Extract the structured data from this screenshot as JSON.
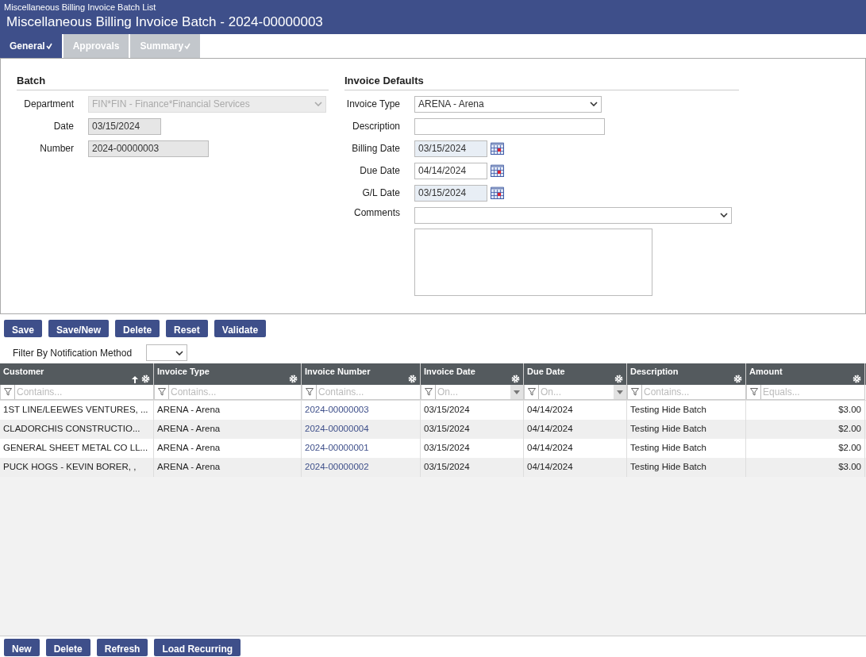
{
  "header": {
    "breadcrumb": "Miscellaneous Billing Invoice Batch List",
    "title": "Miscellaneous Billing Invoice Batch - 2024-00000003"
  },
  "tabs": [
    {
      "label": "General",
      "selected": true,
      "validated": true
    },
    {
      "label": "Approvals",
      "selected": false,
      "validated": false
    },
    {
      "label": "Summary",
      "selected": false,
      "validated": true
    }
  ],
  "batch": {
    "heading": "Batch",
    "fields": [
      {
        "label": "Department",
        "kind": "select",
        "value": "FIN*FIN - Finance*Financial Services",
        "disabled": true
      },
      {
        "label": "Date",
        "kind": "text",
        "value": "03/15/2024",
        "disabled": true
      },
      {
        "label": "Number",
        "kind": "text",
        "value": "2024-00000003",
        "disabled": true
      }
    ]
  },
  "invoice_defaults": {
    "heading": "Invoice Defaults",
    "fields": [
      {
        "label": "Invoice Type",
        "kind": "select",
        "value": "ARENA - Arena",
        "disabled": false
      },
      {
        "label": "Description",
        "kind": "text",
        "disabled": false
      },
      {
        "label": "Billing Date",
        "kind": "date",
        "value": "03/15/2024",
        "disabled": true
      },
      {
        "label": "Due Date",
        "kind": "date",
        "value": "04/14/2024",
        "disabled": false
      },
      {
        "label": "G/L Date",
        "kind": "date",
        "value": "03/15/2024",
        "disabled": true
      },
      {
        "label": "Comments",
        "kind": "memo",
        "disabled": false
      }
    ]
  },
  "form_buttons": [
    "Save",
    "Save/New",
    "Delete",
    "Reset",
    "Validate"
  ],
  "filter": {
    "label": "Filter By Notification Method"
  },
  "grid": {
    "columns": [
      {
        "title": "Customer",
        "sorted": true,
        "filter_placeholder": "Contains...",
        "filter_dropdown": false,
        "link": false,
        "align_right": false
      },
      {
        "title": "Invoice Type",
        "sorted": false,
        "filter_placeholder": "Contains...",
        "filter_dropdown": false,
        "link": false,
        "align_right": false
      },
      {
        "title": "Invoice Number",
        "sorted": false,
        "filter_placeholder": "Contains...",
        "filter_dropdown": false,
        "link": true,
        "align_right": false
      },
      {
        "title": "Invoice Date",
        "sorted": false,
        "filter_placeholder": "On...",
        "filter_dropdown": true,
        "link": false,
        "align_right": false
      },
      {
        "title": "Due Date",
        "sorted": false,
        "filter_placeholder": "On...",
        "filter_dropdown": true,
        "link": false,
        "align_right": false
      },
      {
        "title": "Description",
        "sorted": false,
        "filter_placeholder": "Contains...",
        "filter_dropdown": false,
        "link": false,
        "align_right": false
      },
      {
        "title": "Amount",
        "sorted": false,
        "filter_placeholder": "Equals...",
        "filter_dropdown": false,
        "link": false,
        "align_right": true
      }
    ],
    "rows": [
      {
        "cells": [
          "1ST LINE/LEEWES VENTURES, ...",
          "ARENA - Arena",
          "2024-00000003",
          "03/15/2024",
          "04/14/2024",
          "Testing Hide Batch",
          "$3.00"
        ]
      },
      {
        "cells": [
          "CLADORCHIS CONSTRUCTIO...",
          "ARENA - Arena",
          "2024-00000004",
          "03/15/2024",
          "04/14/2024",
          "Testing Hide Batch",
          "$2.00"
        ]
      },
      {
        "cells": [
          "GENERAL SHEET METAL CO LL...",
          "ARENA - Arena",
          "2024-00000001",
          "03/15/2024",
          "04/14/2024",
          "Testing Hide Batch",
          "$2.00"
        ]
      },
      {
        "cells": [
          "PUCK HOGS - KEVIN BORER, ,",
          "ARENA - Arena",
          "2024-00000002",
          "03/15/2024",
          "04/14/2024",
          "Testing Hide Batch",
          "$3.00"
        ]
      }
    ]
  },
  "grid_buttons": [
    "New",
    "Delete",
    "Refresh",
    "Load Recurring"
  ]
}
